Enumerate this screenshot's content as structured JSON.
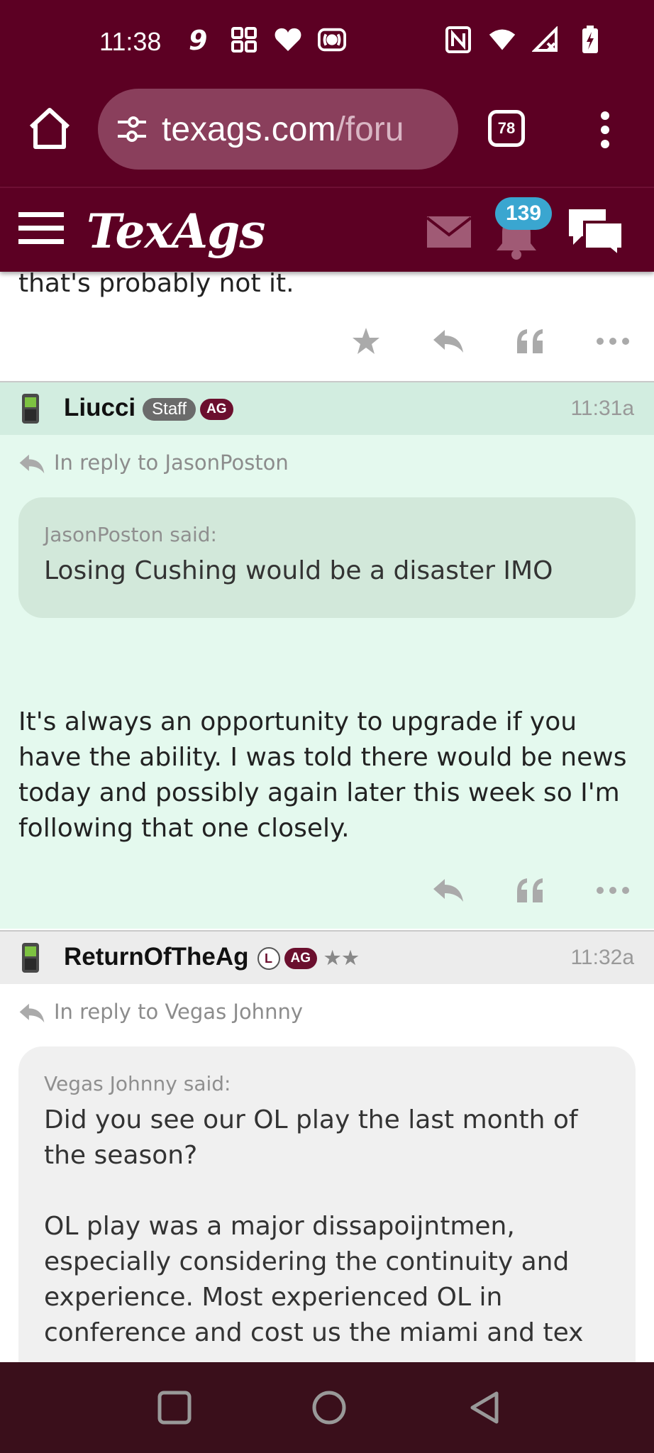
{
  "status_bar": {
    "time": "11:38",
    "left_icons": [
      "carrier-9-icon",
      "grid-apps-icon",
      "heart-icon",
      "radio-icon"
    ],
    "right_icons": [
      "nfc-icon",
      "wifi-icon",
      "signal-icon",
      "battery-charging-icon"
    ]
  },
  "browser": {
    "url_main": "texags.com",
    "url_rest": "/foru",
    "tab_count": "78"
  },
  "site_header": {
    "logo": "TexAgs",
    "notification_count": "139"
  },
  "previous_post": {
    "tail_text": "that's probably not it."
  },
  "posts": [
    {
      "author": "Liucci",
      "badges": [
        "Staff",
        "AG"
      ],
      "time": "11:31a",
      "reply_to": "In reply to JasonPoston",
      "quote_author": "JasonPoston said:",
      "quote_text": "Losing Cushing would be a disaster IMO",
      "body": "It's always an opportunity to upgrade if you have the ability. I was told there would be news today and possibly again later this week so I'm following that one closely.",
      "colors": {
        "header": "#d2ede0",
        "body": "#e4f9ee",
        "quote": "#d2e8da"
      }
    },
    {
      "author": "ReturnOfTheAg",
      "badges": [
        "L",
        "AG"
      ],
      "stars": "★★",
      "time": "11:32a",
      "reply_to": "In reply to Vegas Johnny",
      "quote_author": "Vegas Johnny said:",
      "quote_text": "Did you see our OL play the last month of the season?\n\nOL play was a major dissapoijntmen, especially considering the continuity and experience. Most experienced OL in conference and cost us the miami and tex",
      "colors": {
        "header": "#ececec",
        "body": "#ffffff",
        "quote": "#f0f0f0"
      }
    }
  ],
  "colors": {
    "brand_maroon": "#5c0023",
    "url_pill": "#8a3f5c",
    "badge_blue": "#3aa6d0",
    "nav_bar": "#3a0f1b"
  }
}
